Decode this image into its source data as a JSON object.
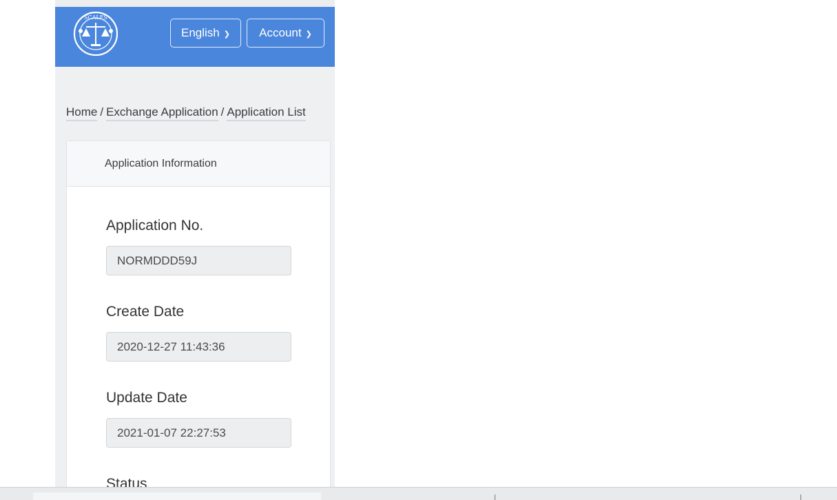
{
  "header": {
    "logo_text": "SCALES",
    "language_button": "English",
    "account_button": "Account",
    "chevron": "⌄"
  },
  "breadcrumb": {
    "home": "Home",
    "separator": "/",
    "exchange": "Exchange Application",
    "list": "Application List"
  },
  "card": {
    "title": "Application Information",
    "fields": [
      {
        "label": "Application No.",
        "value": "NORMDDD59J"
      },
      {
        "label": "Create Date",
        "value": "2020-12-27 11:43:36"
      },
      {
        "label": "Update Date",
        "value": "2021-01-07 22:27:53"
      },
      {
        "label": "Status",
        "value": ""
      }
    ]
  },
  "colors": {
    "header_bg": "#4a86dc",
    "page_bg": "#eef0f2"
  }
}
